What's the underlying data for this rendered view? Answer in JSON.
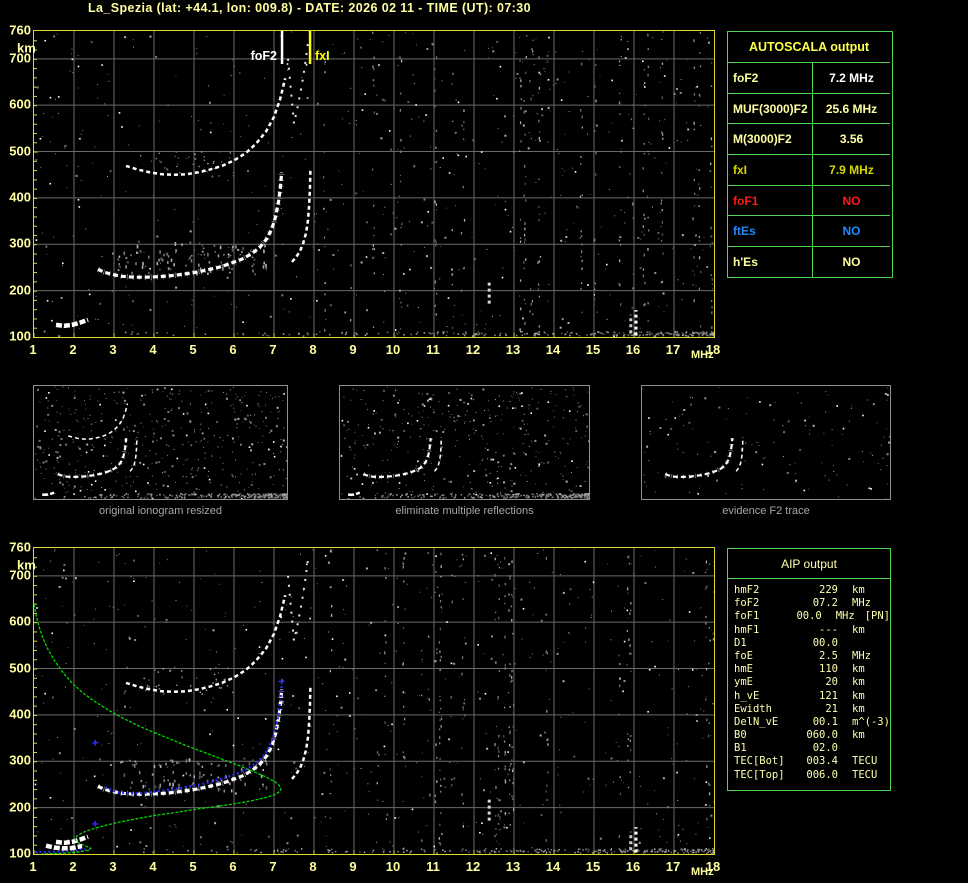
{
  "title": "La_Spezia (lat: +44.1, lon: 009.8) - DATE: 2026 02 11 - TIME (UT): 07:30",
  "colors": {
    "background": "#000000",
    "axis_text": "#ffffa0",
    "plot_border": "#e0da33",
    "grid": "#6a6a6a",
    "table_border": "#4fd44f",
    "pale_yellow": "#ffffa0",
    "bright_yellow": "#ffff00",
    "dark_yellow": "#d6d600",
    "white": "#ffffff",
    "red": "#ff1a1a",
    "blue": "#2288ff",
    "profile_green": "#00d800",
    "trace_blue": "#2a2aff",
    "caption_gray": "#a6a6a6"
  },
  "autoscala_table": {
    "header": "AUTOSCALA output",
    "rows": [
      {
        "label": "foF2",
        "value": "7.2 MHz",
        "label_color": "#ffffa0",
        "value_color": "#ffffff"
      },
      {
        "label": "MUF(3000)F2",
        "value": "25.6 MHz",
        "label_color": "#ffffa0",
        "value_color": "#ffffa0"
      },
      {
        "label": "M(3000)F2",
        "value": "3.56",
        "label_color": "#ffffa0",
        "value_color": "#ffffa0"
      },
      {
        "label": "fxI",
        "value": "7.9 MHz",
        "label_color": "#d6d600",
        "value_color": "#d6d600"
      },
      {
        "label": "foF1",
        "value": "NO",
        "label_color": "#ff1a1a",
        "value_color": "#ff1a1a"
      },
      {
        "label": "ftEs",
        "value": "NO",
        "label_color": "#2288ff",
        "value_color": "#2288ff"
      },
      {
        "label": "h'Es",
        "value": "NO",
        "label_color": "#ffffa0",
        "value_color": "#ffffa0"
      }
    ]
  },
  "aip_table": {
    "header": "AIP output",
    "rows": [
      {
        "label": "hmF2",
        "value": "229",
        "unit": "km",
        "note": ""
      },
      {
        "label": "foF2",
        "value": "07.2",
        "unit": "MHz",
        "note": ""
      },
      {
        "label": "foF1",
        "value": "00.0",
        "unit": "MHz",
        "note": "[PN]"
      },
      {
        "label": "hmF1",
        "value": "---",
        "unit": "km",
        "note": ""
      },
      {
        "label": "D1",
        "value": "00.0",
        "unit": "",
        "note": ""
      },
      {
        "label": "foE",
        "value": "2.5",
        "unit": "MHz",
        "note": ""
      },
      {
        "label": "hmE",
        "value": "110",
        "unit": "km",
        "note": ""
      },
      {
        "label": "ymE",
        "value": "20",
        "unit": "km",
        "note": ""
      },
      {
        "label": "h_vE",
        "value": "121",
        "unit": "km",
        "note": ""
      },
      {
        "label": "Ewidth",
        "value": "21",
        "unit": "km",
        "note": ""
      },
      {
        "label": "DelN_vE",
        "value": "00.1",
        "unit": "m^(-3)",
        "note": ""
      },
      {
        "label": "B0",
        "value": "060.0",
        "unit": "km",
        "note": ""
      },
      {
        "label": "B1",
        "value": "02.0",
        "unit": "",
        "note": ""
      },
      {
        "label": "TEC[Bot]",
        "value": "003.4",
        "unit": "TECU",
        "note": ""
      },
      {
        "label": "TEC[Top]",
        "value": "006.0",
        "unit": "TECU",
        "note": ""
      }
    ]
  },
  "thumbnails": [
    {
      "caption": "original ionogram resized"
    },
    {
      "caption": "eliminate multiple reflections"
    },
    {
      "caption": "evidence F2 trace"
    }
  ],
  "chart_data": [
    {
      "id": "top_ionogram",
      "type": "scatter",
      "title": "autoscaled ionogram",
      "xlabel": "MHz",
      "ylabel": "km",
      "xlim": [
        1,
        18
      ],
      "ylim": [
        100,
        760
      ],
      "x_ticks": [
        1,
        2,
        3,
        4,
        5,
        6,
        7,
        8,
        9,
        10,
        11,
        12,
        13,
        14,
        15,
        16,
        17,
        18
      ],
      "y_ticks": [
        760,
        700,
        600,
        500,
        400,
        300,
        200,
        100
      ],
      "x_unit": "MHz",
      "y_unit": "km",
      "grid": true,
      "background_noise": "random speckle echoes, denser vertical RFI stripes on right half and along bottom edge",
      "markers": [
        {
          "id": "foF2",
          "label": "foF2",
          "x": 7.2,
          "color": "#ffffff",
          "side": "left"
        },
        {
          "id": "fxI",
          "label": "fxI",
          "x": 7.9,
          "color": "#ffff00",
          "side": "right"
        }
      ],
      "series": [
        {
          "id": "f2_o",
          "name": "F2 trace o-mode",
          "color": "#ffffff",
          "style": "trace",
          "points": [
            [
              2.6,
              246
            ],
            [
              2.75,
              240
            ],
            [
              2.95,
              235
            ],
            [
              3.2,
              231
            ],
            [
              3.5,
              229
            ],
            [
              3.8,
              229
            ],
            [
              4.1,
              230
            ],
            [
              4.4,
              232
            ],
            [
              4.7,
              235
            ],
            [
              5.0,
              239
            ],
            [
              5.3,
              244
            ],
            [
              5.6,
              250
            ],
            [
              5.9,
              258
            ],
            [
              6.2,
              268
            ],
            [
              6.45,
              280
            ],
            [
              6.65,
              294
            ],
            [
              6.82,
              312
            ],
            [
              6.95,
              334
            ],
            [
              7.04,
              360
            ],
            [
              7.11,
              390
            ],
            [
              7.16,
              422
            ],
            [
              7.19,
              455
            ]
          ]
        },
        {
          "id": "f2_x",
          "name": "F2 trace x-mode",
          "color": "#ffffff",
          "style": "trace2",
          "points": [
            [
              7.45,
              262
            ],
            [
              7.55,
              272
            ],
            [
              7.65,
              285
            ],
            [
              7.73,
              302
            ],
            [
              7.8,
              324
            ],
            [
              7.85,
              352
            ],
            [
              7.88,
              386
            ],
            [
              7.9,
              424
            ],
            [
              7.91,
              460
            ]
          ]
        },
        {
          "id": "multiple",
          "name": "second reflection of F2 trace",
          "color": "#ffffff",
          "style": "trace2",
          "points": [
            [
              3.3,
              469
            ],
            [
              3.6,
              461
            ],
            [
              3.9,
              455
            ],
            [
              4.2,
              451
            ],
            [
              4.5,
              450
            ],
            [
              4.8,
              451
            ],
            [
              5.1,
              455
            ],
            [
              5.4,
              461
            ],
            [
              5.7,
              469
            ],
            [
              6.0,
              481
            ],
            [
              6.3,
              497
            ],
            [
              6.55,
              517
            ],
            [
              6.8,
              543
            ],
            [
              7.0,
              575
            ],
            [
              7.15,
              612
            ],
            [
              7.28,
              658
            ]
          ]
        },
        {
          "id": "multiple_tail",
          "name": "second reflection asymptote",
          "color": "#e8e8e8",
          "style": "sparse",
          "points": [
            [
              7.35,
              700
            ],
            [
              7.5,
              560
            ],
            [
              7.6,
              600
            ],
            [
              7.7,
              645
            ],
            [
              7.78,
              690
            ],
            [
              7.85,
              735
            ]
          ]
        },
        {
          "id": "es",
          "name": "E-region echo",
          "color": "#ffffff",
          "style": "blob",
          "points": [
            [
              1.55,
              126
            ],
            [
              1.75,
              124
            ],
            [
              1.95,
              126
            ],
            [
              2.15,
              131
            ],
            [
              2.35,
              137
            ]
          ]
        },
        {
          "id": "rfi124",
          "name": "interference 12.4 MHz",
          "color": "#d8d8d8",
          "style": "vline",
          "points": [
            [
              12.38,
              172
            ],
            [
              12.38,
              218
            ]
          ]
        },
        {
          "id": "rfi16a",
          "name": "interference 16 MHz",
          "color": "#ffffff",
          "style": "vline",
          "points": [
            [
              16.05,
              103
            ],
            [
              16.05,
              158
            ]
          ]
        },
        {
          "id": "rfi16b",
          "name": "interference 15.9 MHz",
          "color": "#cccccc",
          "style": "vline",
          "points": [
            [
              15.92,
              108
            ],
            [
              15.92,
              148
            ]
          ]
        }
      ]
    },
    {
      "id": "bottom_ionogram",
      "type": "scatter",
      "title": "ionogram with restored trace and electron density profile",
      "xlabel": "MHz",
      "ylabel": "km",
      "xlim": [
        1,
        18
      ],
      "ylim": [
        100,
        760
      ],
      "x_ticks": [
        1,
        2,
        3,
        4,
        5,
        6,
        7,
        8,
        9,
        10,
        11,
        12,
        13,
        14,
        15,
        16,
        17,
        18
      ],
      "y_ticks": [
        760,
        700,
        600,
        500,
        400,
        300,
        200,
        100
      ],
      "x_unit": "MHz",
      "y_unit": "km",
      "grid": true,
      "background_noise": "same speckle echoes as top ionogram",
      "series_refs": [
        "f2_o",
        "f2_x",
        "multiple",
        "multiple_tail",
        "es",
        "rfi124",
        "rfi16a",
        "rfi16b"
      ],
      "series": [
        {
          "id": "profile",
          "name": "electron density profile",
          "color": "#00d800",
          "style": "line",
          "points": [
            [
              1.0,
              638
            ],
            [
              1.05,
              616
            ],
            [
              1.12,
              592
            ],
            [
              1.22,
              566
            ],
            [
              1.35,
              541
            ],
            [
              1.52,
              516
            ],
            [
              1.72,
              492
            ],
            [
              1.95,
              469
            ],
            [
              2.2,
              449
            ],
            [
              2.5,
              430
            ],
            [
              2.85,
              411
            ],
            [
              3.2,
              394
            ],
            [
              3.6,
              377
            ],
            [
              4.0,
              362
            ],
            [
              4.4,
              348
            ],
            [
              4.8,
              334
            ],
            [
              5.2,
              321
            ],
            [
              5.6,
              308
            ],
            [
              6.0,
              295
            ],
            [
              6.4,
              281
            ],
            [
              6.75,
              268
            ],
            [
              7.0,
              257
            ],
            [
              7.12,
              249
            ],
            [
              7.17,
              242
            ],
            [
              7.16,
              236
            ],
            [
              7.05,
              229
            ],
            [
              6.8,
              222
            ],
            [
              6.45,
              215
            ],
            [
              6.0,
              208
            ],
            [
              5.5,
              202
            ],
            [
              5.0,
              196
            ],
            [
              4.5,
              189
            ],
            [
              4.0,
              183
            ],
            [
              3.55,
              176
            ],
            [
              3.15,
              169
            ],
            [
              2.8,
              162
            ],
            [
              2.5,
              155
            ],
            [
              2.27,
              148
            ],
            [
              2.1,
              141
            ],
            [
              2.02,
              134
            ],
            [
              2.05,
              128
            ],
            [
              2.15,
              122
            ],
            [
              2.3,
              117
            ],
            [
              2.42,
              112
            ],
            [
              2.35,
              108
            ],
            [
              2.1,
              104
            ],
            [
              1.8,
              102
            ],
            [
              1.5,
              101
            ],
            [
              1.2,
              100
            ]
          ]
        },
        {
          "id": "blue_f2",
          "name": "restored F2 trace",
          "color": "#2a2aff",
          "style": "dots",
          "points": [
            [
              2.78,
              244
            ],
            [
              2.95,
              237
            ],
            [
              3.15,
              232
            ],
            [
              3.4,
              230
            ],
            [
              3.65,
              231
            ],
            [
              3.9,
              233
            ],
            [
              4.15,
              236
            ],
            [
              4.4,
              239
            ],
            [
              4.65,
              242
            ],
            [
              4.9,
              246
            ],
            [
              5.15,
              250
            ],
            [
              5.4,
              255
            ],
            [
              5.65,
              261
            ],
            [
              5.9,
              268
            ],
            [
              6.15,
              276
            ],
            [
              6.38,
              286
            ],
            [
              6.58,
              298
            ],
            [
              6.75,
              313
            ],
            [
              6.88,
              331
            ],
            [
              6.98,
              352
            ],
            [
              7.06,
              377
            ],
            [
              7.12,
              404
            ],
            [
              7.16,
              433
            ],
            [
              7.19,
              462
            ]
          ]
        },
        {
          "id": "blue_e",
          "name": "restored E trace",
          "color": "#2a2aff",
          "style": "dots",
          "points": [
            [
              1.02,
              104
            ],
            [
              1.2,
              104
            ],
            [
              1.38,
              105
            ],
            [
              1.56,
              105
            ],
            [
              1.74,
              106
            ],
            [
              1.92,
              107
            ],
            [
              2.1,
              109
            ],
            [
              2.28,
              111
            ]
          ]
        },
        {
          "id": "blue_plus",
          "name": "isolated trace points",
          "color": "#2a2aff",
          "style": "plus",
          "points": [
            [
              2.53,
              340
            ],
            [
              7.19,
              472
            ],
            [
              2.53,
              165
            ]
          ]
        },
        {
          "id": "es2",
          "name": "E-region echo lower",
          "color": "#ffffff",
          "style": "blob",
          "points": [
            [
              1.3,
              118
            ],
            [
              1.5,
              114
            ],
            [
              1.7,
              112
            ],
            [
              1.95,
              113
            ],
            [
              2.2,
              117
            ]
          ]
        }
      ]
    },
    {
      "id": "thumb_original",
      "type": "scatter",
      "title": "original ionogram resized",
      "series_refs": [
        "f2_o",
        "f2_x",
        "multiple",
        "es"
      ],
      "background_noise": "dense speckle"
    },
    {
      "id": "thumb_no_multiples",
      "type": "scatter",
      "title": "eliminate multiple reflections",
      "series_refs": [
        "f2_o",
        "f2_x",
        "es"
      ],
      "background_noise": "dense speckle"
    },
    {
      "id": "thumb_evidence",
      "type": "scatter",
      "title": "evidence F2 trace",
      "series_refs": [
        "f2_o",
        "f2_x"
      ],
      "background_noise": "sparse speckle"
    }
  ]
}
